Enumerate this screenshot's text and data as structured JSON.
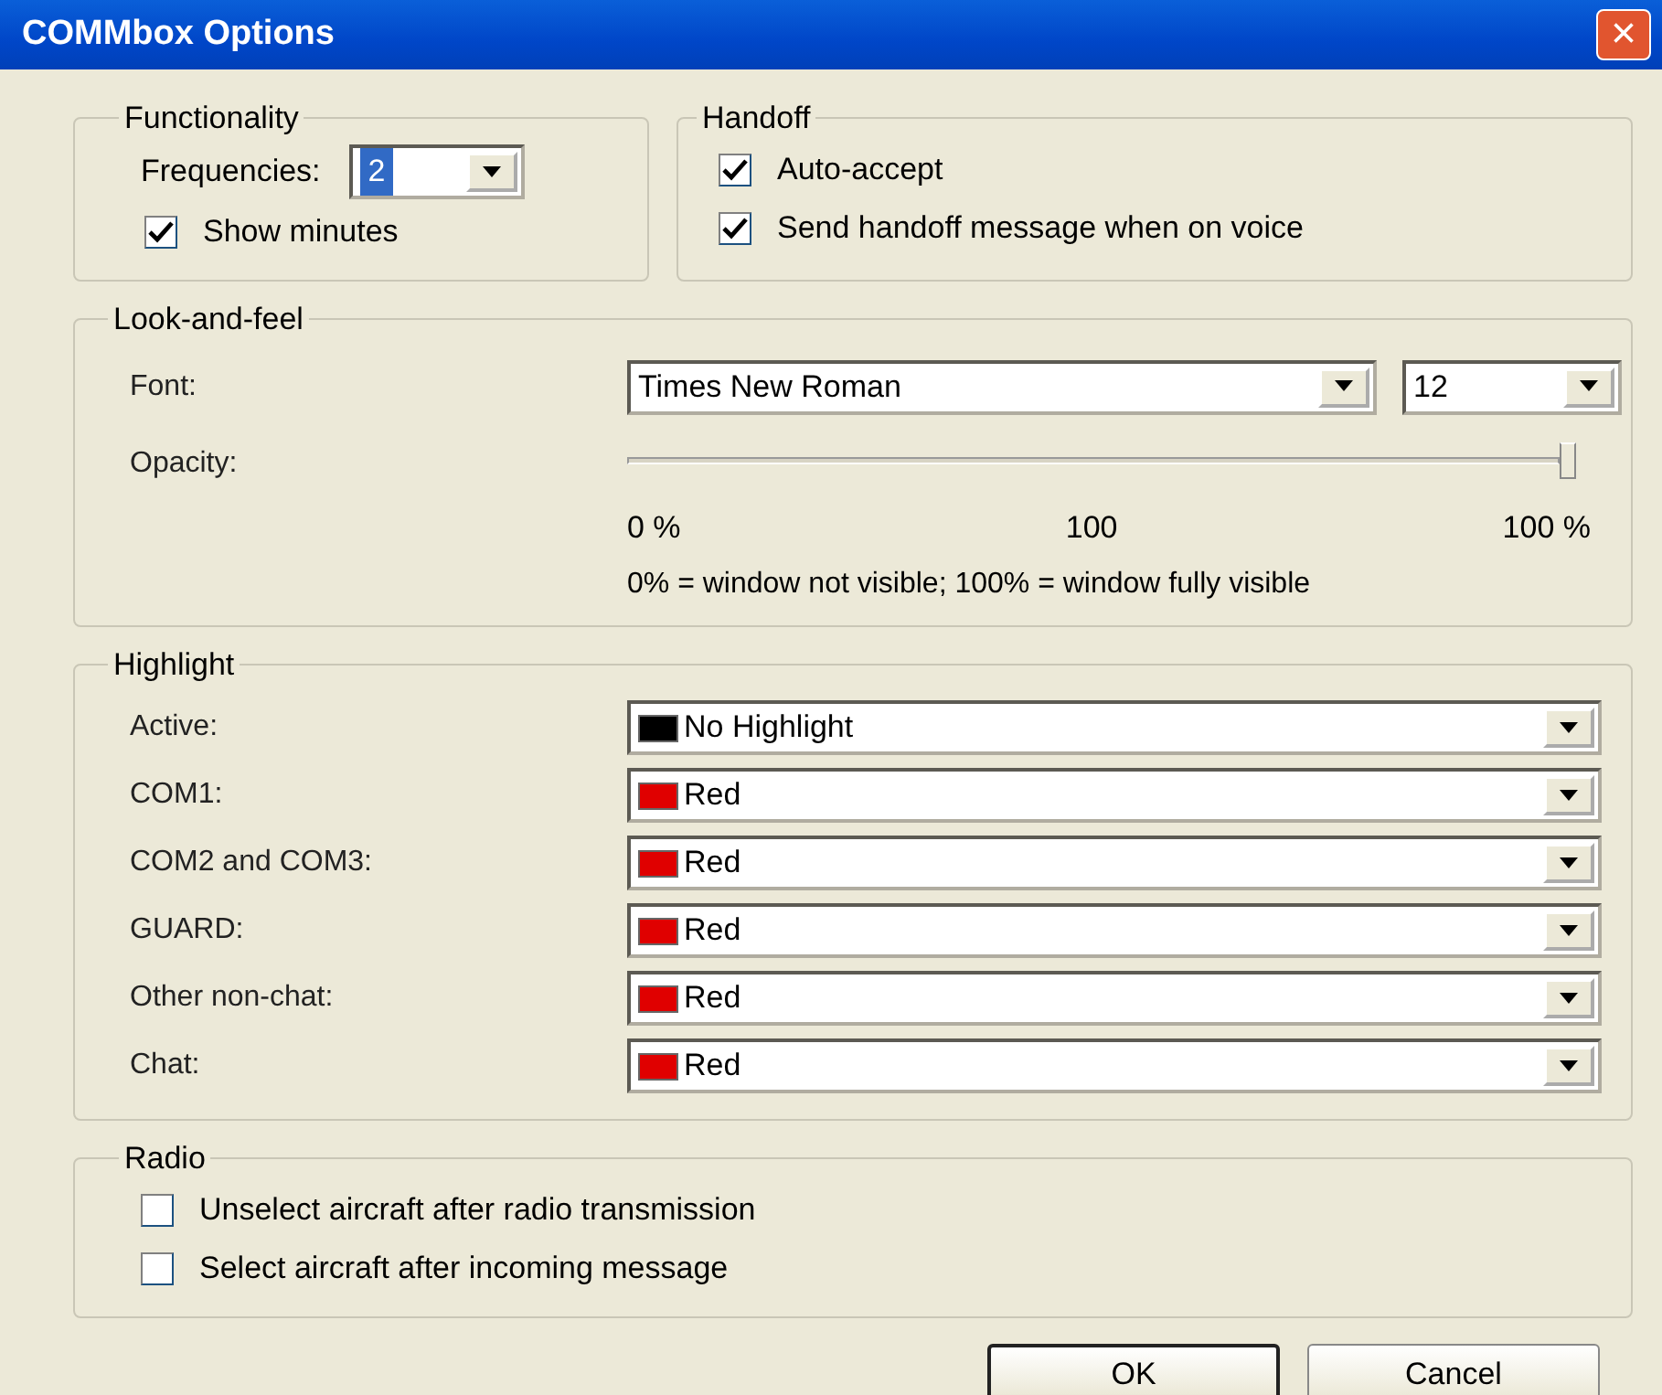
{
  "window": {
    "title": "COMMbox Options",
    "close": "×"
  },
  "functionality": {
    "title": "Functionality",
    "frequencies": {
      "label": "Frequencies:",
      "value": "2",
      "text_selected": true
    },
    "show_minutes": {
      "label": "Show minutes",
      "checked": true
    }
  },
  "handoff": {
    "title": "Handoff",
    "options": [
      {
        "label": "Auto-accept",
        "checked": true
      },
      {
        "label": "Send handoff message when on voice",
        "checked": true
      }
    ]
  },
  "look_and_feel": {
    "title": "Look-and-feel",
    "font": {
      "label": "Font:",
      "value": "Times New Roman"
    },
    "size": {
      "value": "12"
    },
    "opacity": {
      "label": "Opacity:",
      "level": 1.0,
      "ticks": [
        "0 %",
        "100",
        "100 %"
      ],
      "note": "0% = window not visible; 100% = window fully visible"
    }
  },
  "highlight": {
    "title": "Highlight",
    "rows": [
      {
        "label": "Active:",
        "value": "No Highlight",
        "color": "#000000"
      },
      {
        "label": "COM1:",
        "value": "Red",
        "color": "#e00000"
      },
      {
        "label": "COM2 and COM3:",
        "value": "Red",
        "color": "#e00000"
      },
      {
        "label": "GUARD:",
        "value": "Red",
        "color": "#e00000"
      },
      {
        "label": "Other non-chat:",
        "value": "Red",
        "color": "#e00000"
      },
      {
        "label": "Chat:",
        "value": "Red",
        "color": "#e00000"
      }
    ]
  },
  "radio": {
    "title": "Radio",
    "options": [
      {
        "label": "Unselect aircraft after radio transmission",
        "checked": false
      },
      {
        "label": "Select aircraft after incoming message",
        "checked": false
      }
    ]
  },
  "buttons": [
    {
      "label": "OK",
      "default": true
    },
    {
      "label": "Cancel",
      "default": false
    }
  ]
}
